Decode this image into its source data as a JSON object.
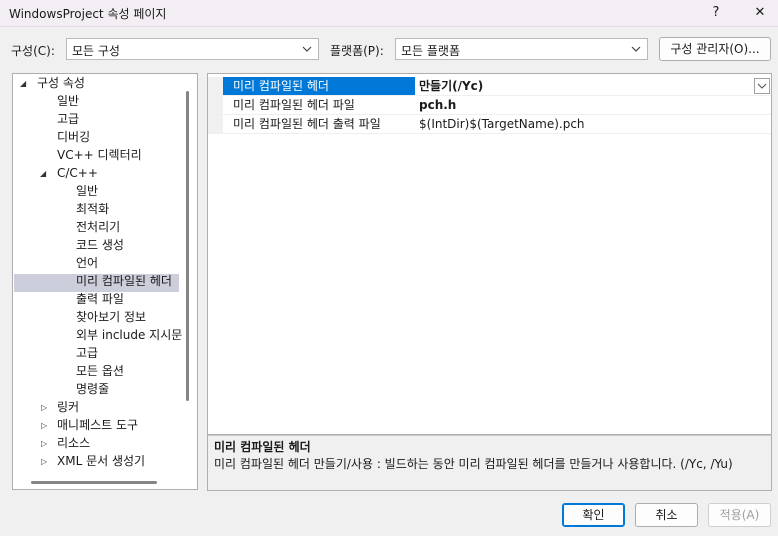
{
  "window": {
    "title": "WindowsProject 속성 페이지",
    "help_label": "?",
    "close_label": "✕"
  },
  "toolbar": {
    "config_label": "구성(C):",
    "config_value": "모든 구성",
    "platform_label": "플랫폼(P):",
    "platform_value": "모든 플랫폼",
    "config_manager_label": "구성 관리자(O)..."
  },
  "tree": {
    "root": "구성 속성",
    "items": {
      "general": "일반",
      "advanced": "고급",
      "debugging": "디버깅",
      "vc_dirs": "VC++ 디렉터리",
      "cpp": "C/C++",
      "cpp_general": "일반",
      "optimization": "최적화",
      "preprocessor": "전처리기",
      "codegen": "코드 생성",
      "language": "언어",
      "pch": "미리 컴파일된 헤더",
      "output_files": "출력 파일",
      "browse_info": "찾아보기 정보",
      "external_include": "외부 include 지시문",
      "cpp_advanced": "고급",
      "all_options": "모든 옵션",
      "command_line": "명령줄",
      "linker": "링커",
      "manifest_tool": "매니페스트 도구",
      "resources": "리소스",
      "xml_doc": "XML 문서 생성기"
    }
  },
  "grid": {
    "rows": [
      {
        "name": "미리 컴파일된 헤더",
        "value": "만들기(/Yc)"
      },
      {
        "name": "미리 컴파일된 헤더 파일",
        "value": "pch.h"
      },
      {
        "name": "미리 컴파일된 헤더 출력 파일",
        "value": "$(IntDir)$(TargetName).pch"
      }
    ]
  },
  "description": {
    "title": "미리 컴파일된 헤더",
    "text": "미리 컴파일된 헤더 만들기/사용 : 빌드하는 동안 미리 컴파일된 헤더를 만들거나 사용합니다.      (/Yc, /Yu)"
  },
  "buttons": {
    "ok": "확인",
    "cancel": "취소",
    "apply": "적용(A)"
  },
  "colors": {
    "selection": "#0078d7",
    "tree_selection": "#cccedb",
    "disabled_text": "#a0a0a0"
  }
}
